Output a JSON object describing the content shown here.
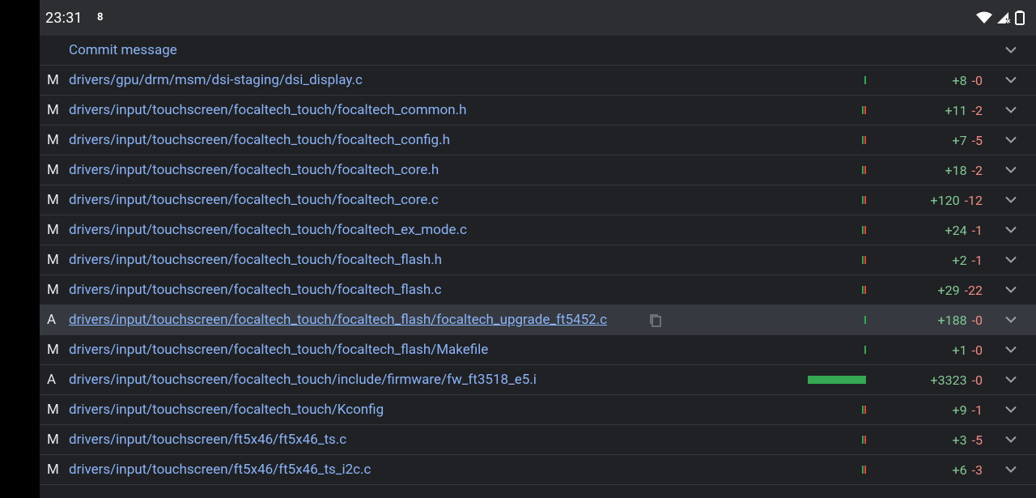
{
  "status_bar": {
    "time": "23:31",
    "notification_badge": "8",
    "icons": [
      "wifi-icon",
      "signal-icon",
      "battery-icon"
    ]
  },
  "header": {
    "label": "Commit message"
  },
  "files": [
    {
      "status": "M",
      "path": "drivers/gpu/drm/msm/dsi-staging/dsi_display.c",
      "plus": "+8",
      "minus": "-0",
      "bar_green": 1,
      "bar_red": 0
    },
    {
      "status": "M",
      "path": "drivers/input/touchscreen/focaltech_touch/focaltech_common.h",
      "plus": "+11",
      "minus": "-2",
      "bar_green": 1,
      "bar_red": 1
    },
    {
      "status": "M",
      "path": "drivers/input/touchscreen/focaltech_touch/focaltech_config.h",
      "plus": "+7",
      "minus": "-5",
      "bar_green": 1,
      "bar_red": 1
    },
    {
      "status": "M",
      "path": "drivers/input/touchscreen/focaltech_touch/focaltech_core.h",
      "plus": "+18",
      "minus": "-2",
      "bar_green": 1,
      "bar_red": 1
    },
    {
      "status": "M",
      "path": "drivers/input/touchscreen/focaltech_touch/focaltech_core.c",
      "plus": "+120",
      "minus": "-12",
      "bar_green": 1,
      "bar_red": 1
    },
    {
      "status": "M",
      "path": "drivers/input/touchscreen/focaltech_touch/focaltech_ex_mode.c",
      "plus": "+24",
      "minus": "-1",
      "bar_green": 1,
      "bar_red": 1
    },
    {
      "status": "M",
      "path": "drivers/input/touchscreen/focaltech_touch/focaltech_flash.h",
      "plus": "+2",
      "minus": "-1",
      "bar_green": 1,
      "bar_red": 1
    },
    {
      "status": "M",
      "path": "drivers/input/touchscreen/focaltech_touch/focaltech_flash.c",
      "plus": "+29",
      "minus": "-22",
      "bar_green": 1,
      "bar_red": 1
    },
    {
      "status": "A",
      "path": "drivers/input/touchscreen/focaltech_touch/focaltech_flash/focaltech_upgrade_ft5452.c",
      "plus": "+188",
      "minus": "-0",
      "bar_green": 1,
      "bar_red": 0,
      "selected": true
    },
    {
      "status": "M",
      "path": "drivers/input/touchscreen/focaltech_touch/focaltech_flash/Makefile",
      "plus": "+1",
      "minus": "-0",
      "bar_green": 1,
      "bar_red": 0
    },
    {
      "status": "A",
      "path": "drivers/input/touchscreen/focaltech_touch/include/firmware/fw_ft3518_e5.i",
      "plus": "+3323",
      "minus": "-0",
      "bar_green": 72,
      "bar_red": 0
    },
    {
      "status": "M",
      "path": "drivers/input/touchscreen/focaltech_touch/Kconfig",
      "plus": "+9",
      "minus": "-1",
      "bar_green": 1,
      "bar_red": 1
    },
    {
      "status": "M",
      "path": "drivers/input/touchscreen/ft5x46/ft5x46_ts.c",
      "plus": "+3",
      "minus": "-5",
      "bar_green": 1,
      "bar_red": 1
    },
    {
      "status": "M",
      "path": "drivers/input/touchscreen/ft5x46/ft5x46_ts_i2c.c",
      "plus": "+6",
      "minus": "-3",
      "bar_green": 1,
      "bar_red": 1
    }
  ],
  "colors": {
    "link": "#8ab4f8",
    "added": "#81c995",
    "removed": "#f28b82",
    "bar_green": "#34a853",
    "bar_red": "#ea4335"
  }
}
